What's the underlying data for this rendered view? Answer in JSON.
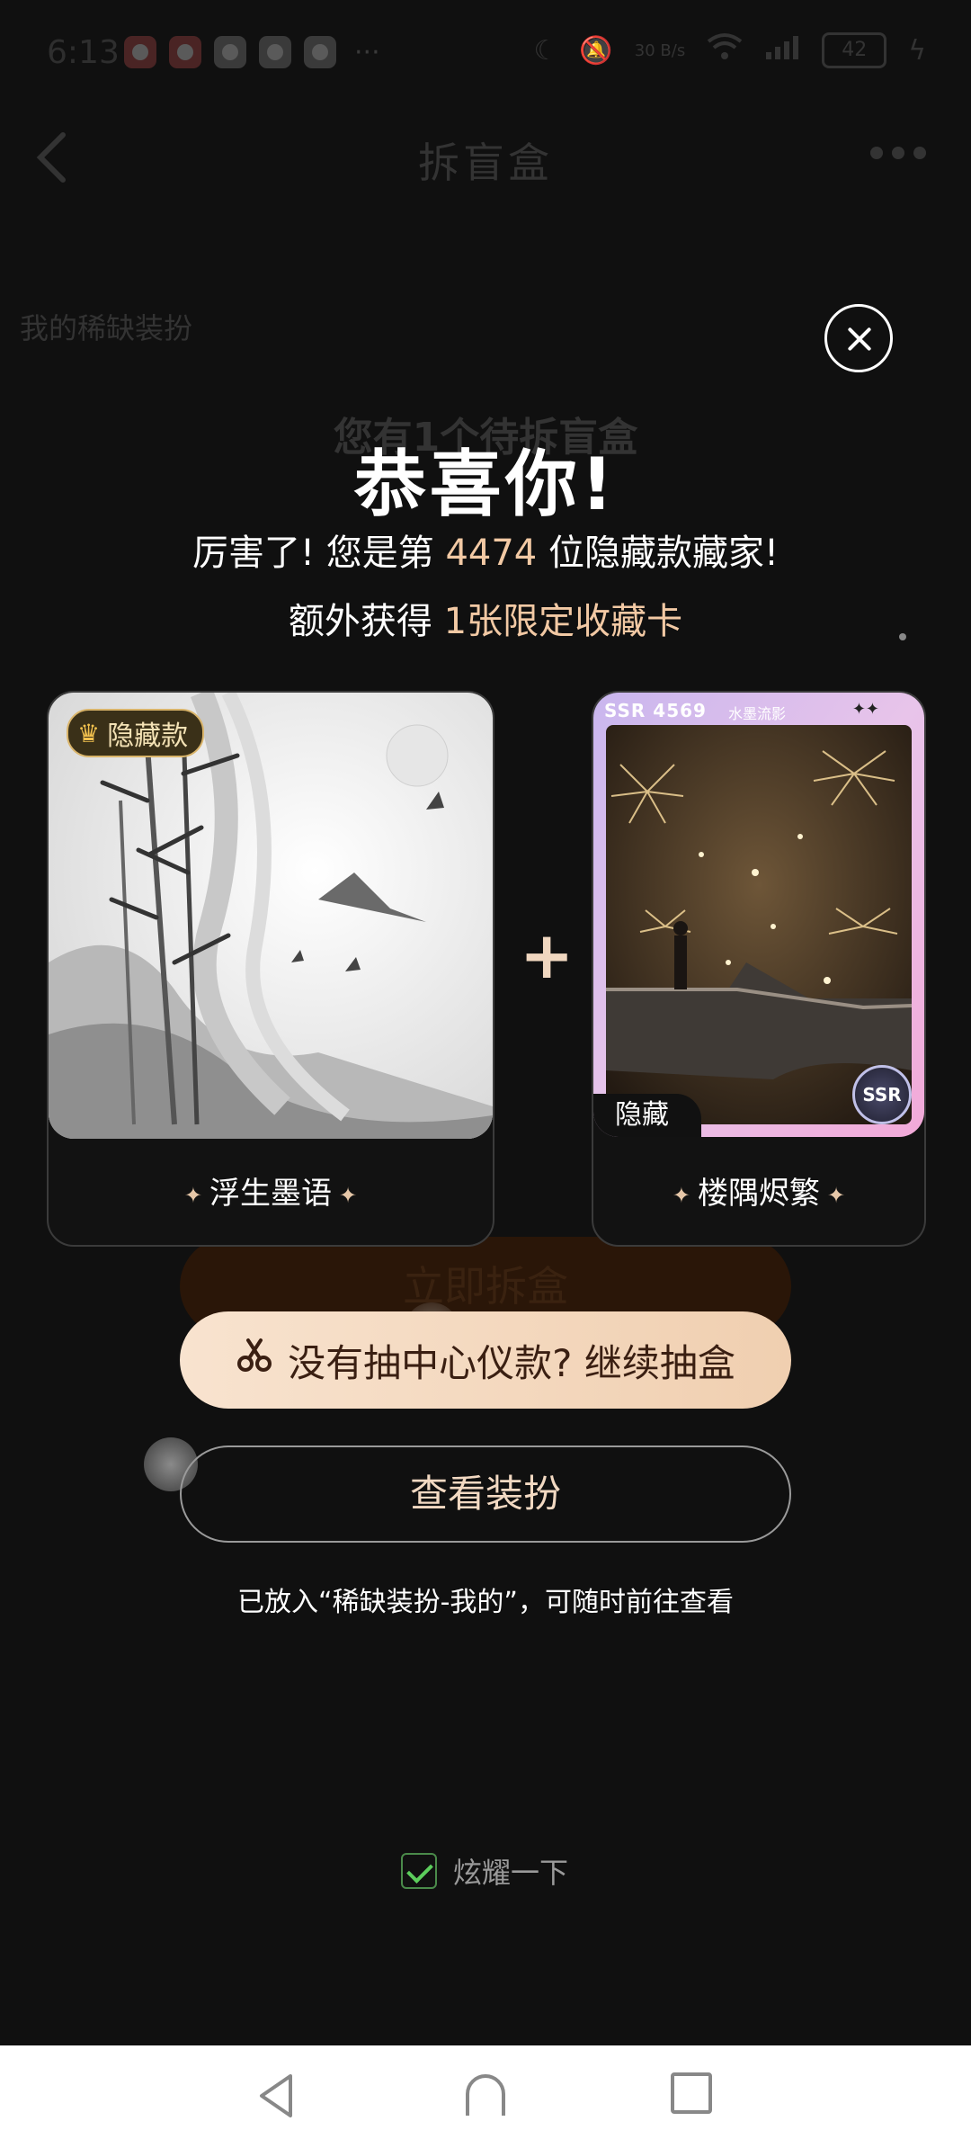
{
  "status_bar": {
    "time": "6:13",
    "network_speed": "30 B/s",
    "battery": "42"
  },
  "header": {
    "title": "拆盲盒"
  },
  "background": {
    "section_title": "我的稀缺装扮",
    "pending_text": "您有1个待拆盲盒",
    "open_button": "立即拆盒"
  },
  "dialog": {
    "title": "恭喜你!",
    "line1_prefix": "厉害了!  您是第 ",
    "collector_rank": "4474",
    "line1_suffix": " 位隐藏款藏家!",
    "line2_prefix": "额外获得 ",
    "line2_highlight": "1张限定收藏卡",
    "cards": [
      {
        "badge": "隐藏款",
        "name": "浮生墨语"
      },
      {
        "badge": "隐藏",
        "serial": "SSR 4569",
        "card_title": "水墨流影",
        "rarity": "SSR",
        "name": "楼隅烬繁"
      }
    ],
    "plus": "+",
    "continue_button": "没有抽中心仪款? 继续抽盒",
    "view_button": "查看装扮",
    "placed_hint": "已放入“稀缺装扮-我的”，可随时前往查看",
    "share_label": "炫耀一下"
  },
  "colors": {
    "accent": "#f2c9a4",
    "overlay_bg": "#101010",
    "button_gradient_start": "#f8e3cf",
    "button_gradient_end": "#f0cfb0"
  }
}
